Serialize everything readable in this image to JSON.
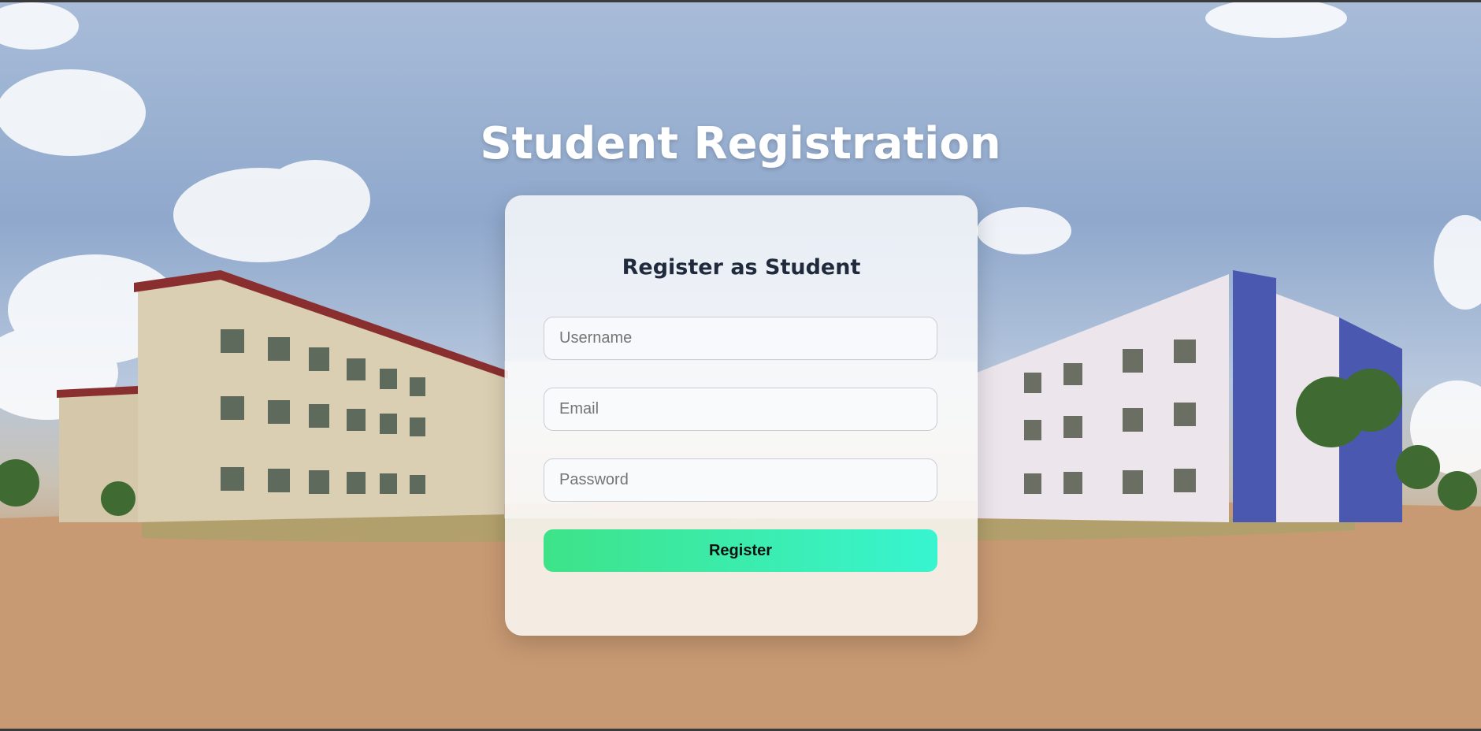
{
  "page": {
    "title": "Student Registration"
  },
  "form": {
    "heading": "Register as Student",
    "fields": [
      {
        "name": "username",
        "placeholder": "Username",
        "value": ""
      },
      {
        "name": "email",
        "placeholder": "Email",
        "value": ""
      },
      {
        "name": "password",
        "placeholder": "Password",
        "value": ""
      }
    ],
    "submit_label": "Register"
  },
  "colors": {
    "button_gradient_start": "#3ee388",
    "button_gradient_end": "#38f5d0",
    "heading": "#1f2a3c",
    "title": "#ffffff"
  }
}
